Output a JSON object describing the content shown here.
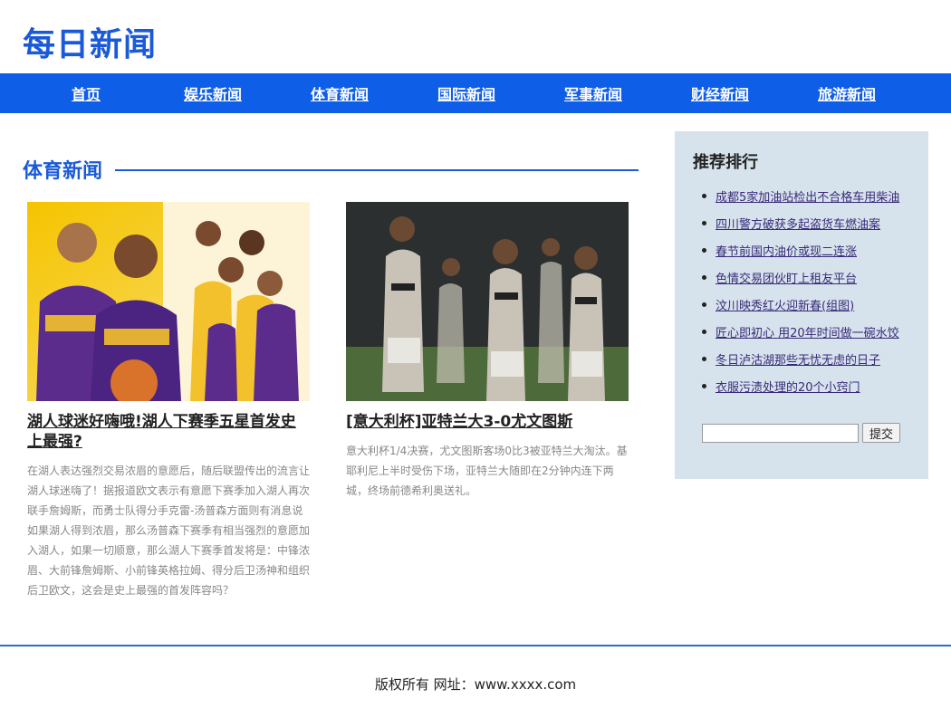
{
  "site": {
    "logo": "每日新闻"
  },
  "nav": {
    "items": [
      {
        "label": "首页"
      },
      {
        "label": "娱乐新闻"
      },
      {
        "label": "体育新闻"
      },
      {
        "label": "国际新闻"
      },
      {
        "label": "军事新闻"
      },
      {
        "label": "财经新闻"
      },
      {
        "label": "旅游新闻"
      }
    ]
  },
  "section": {
    "title": "体育新闻"
  },
  "articles": [
    {
      "title": "湖人球迷好嗨哦!湖人下赛季五星首发史上最强?",
      "summary": "在湖人表达强烈交易浓眉的意愿后，随后联盟传出的流言让湖人球迷嗨了！据报道欧文表示有意愿下赛季加入湖人再次联手詹姆斯，而勇士队得分手克雷-汤普森方面则有消息说如果湖人得到浓眉，那么汤普森下赛季有相当强烈的意愿加入湖人，如果一切顺意，那么湖人下赛季首发将是：中锋浓眉、大前锋詹姆斯、小前锋英格拉姆、得分后卫汤神和组织后卫欧文，这会是史上最强的首发阵容吗？",
      "image": "lakers-players-photo"
    },
    {
      "title": "[意大利杯]亚特兰大3-0尤文图斯",
      "summary": "意大利杯1/4决赛，尤文图斯客场0比3被亚特兰大淘汰。基耶利尼上半时受伤下场，亚特兰大随即在2分钟内连下两城，终场前德希利奥送礼。",
      "image": "juventus-players-photo"
    }
  ],
  "sidebar": {
    "title": "推荐排行",
    "items": [
      {
        "label": "成都5家加油站检出不合格车用柴油"
      },
      {
        "label": "四川警方破获多起盗货车燃油案"
      },
      {
        "label": "春节前国内油价或现二连涨"
      },
      {
        "label": "色情交易团伙盯上租友平台"
      },
      {
        "label": "汶川映秀红火迎新春(组图)"
      },
      {
        "label": "匠心即初心 用20年时间做一碗水饺"
      },
      {
        "label": "冬日泸沽湖那些无忧无虑的日子"
      },
      {
        "label": "衣服污渍处理的20个小窍门"
      }
    ],
    "search": {
      "value": "",
      "submit_label": "提交"
    }
  },
  "footer": {
    "text": "版权所有 网址：www.xxxx.com"
  },
  "colors": {
    "brand": "#1a5ad8",
    "nav_bg": "#0f5ee8",
    "sidebar_bg": "#d6e3ec"
  }
}
